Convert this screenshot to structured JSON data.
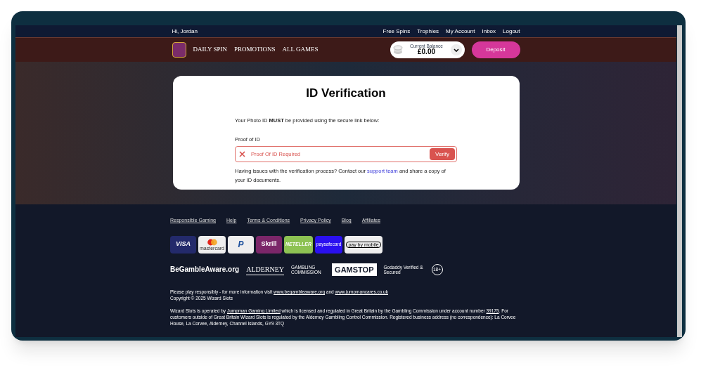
{
  "top_bar": {
    "greeting": "Hi, Jordan",
    "links": [
      "Free Spins",
      "Trophies",
      "My Account",
      "Inbox",
      "Logout"
    ]
  },
  "nav": {
    "items": [
      "DAILY SPIN",
      "PROMOTIONS",
      "ALL GAMES"
    ],
    "balance": {
      "label": "Current Balance",
      "amount": "£0.00"
    },
    "deposit": "Deposit"
  },
  "verification": {
    "title": "ID Verification",
    "intro": "Your Photo ID **MUST** be provided using the secure link below:",
    "field_label": "Proof of ID",
    "field": {
      "value": "Proof Of ID Required",
      "error": true
    },
    "verify_button": "Verify",
    "help": [
      {
        "text": "Having issues with the verification process? Contact our ",
        "link": false
      },
      {
        "text": "support team",
        "link": true
      },
      {
        "text": " and share a copy of your ID documents.",
        "link": false
      }
    ]
  },
  "footer": {
    "links": [
      "Responsible Gaming",
      "Help",
      "Terms & Conditions",
      "Privacy Policy",
      "Blog",
      "Affiliates"
    ],
    "payments": [
      {
        "kind": "visa",
        "text": "VISA"
      },
      {
        "kind": "mastercard",
        "text": "mastercard"
      },
      {
        "kind": "paypal",
        "text": "P"
      },
      {
        "kind": "skrill",
        "text": "Skrill"
      },
      {
        "kind": "neteller",
        "text": "NETELLER"
      },
      {
        "kind": "paysafecard",
        "text": "paysafecard"
      },
      {
        "kind": "paybymobile",
        "text": "pay by mobile"
      }
    ],
    "badges": [
      {
        "kind": "begambleaware",
        "text": "BeGambleAware.org"
      },
      {
        "kind": "alderney",
        "text": "ALDERNEY"
      },
      {
        "kind": "commission",
        "text": "GAMBLING COMMISSION"
      },
      {
        "kind": "gamstop",
        "text": "GAMSTOP"
      },
      {
        "kind": "godaddy",
        "text": "Godaddy Verified & Secured"
      },
      {
        "kind": "age",
        "text": "18+"
      }
    ],
    "paragraphs": [
      [
        {
          "text": "Please play responsibly - for more information visit ",
          "link": false
        },
        {
          "text": "www.begambleaware.org",
          "link": true
        },
        {
          "text": " and ",
          "link": false
        },
        {
          "text": "www.jumpmancares.co.uk",
          "link": true
        }
      ],
      [
        {
          "text": "Copyright © 2025 Wizard Slots",
          "link": false
        }
      ],
      [
        {
          "text": "Wizard Slots is operated by ",
          "link": false
        },
        {
          "text": "Jumpman Gaming Limited",
          "link": true
        },
        {
          "text": " which is licensed and regulated in Great Britain by the Gambling Commission under account number ",
          "link": false
        },
        {
          "text": "39175",
          "link": true
        },
        {
          "text": ". For customers outside of Great Britain Wizard Slots is regulated by the Alderney Gambling Control Commission. Registered business address (no correspondence): La Corvee House, La Corvee, Alderney, Channel Islands, GY9 3TQ",
          "link": false
        }
      ]
    ]
  }
}
